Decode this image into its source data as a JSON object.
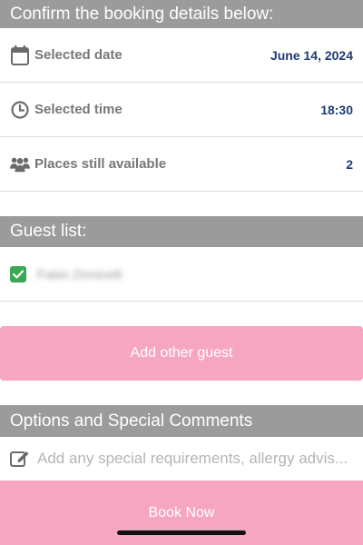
{
  "booking": {
    "header": "Confirm the booking details below:",
    "rows": [
      {
        "label": "Selected date",
        "value": "June 14, 2024",
        "icon": "calendar-icon"
      },
      {
        "label": "Selected time",
        "value": "18:30",
        "icon": "clock-icon"
      },
      {
        "label": "Places still available",
        "value": "2",
        "icon": "people-icon"
      }
    ]
  },
  "guests": {
    "header": "Guest list:",
    "items": [
      {
        "name": "Fabio Zinnicelli",
        "checked": true
      }
    ],
    "add_button_label": "Add other guest"
  },
  "options": {
    "header": "Options and Special Comments",
    "placeholder": "Add any special requirements, allergy advis..."
  },
  "footer": {
    "book_button_label": "Book Now"
  },
  "colors": {
    "header_bg": "#9b9b9b",
    "accent_pink": "#f7a6c1",
    "value_blue": "#1f3b73",
    "check_green": "#3aa856"
  }
}
